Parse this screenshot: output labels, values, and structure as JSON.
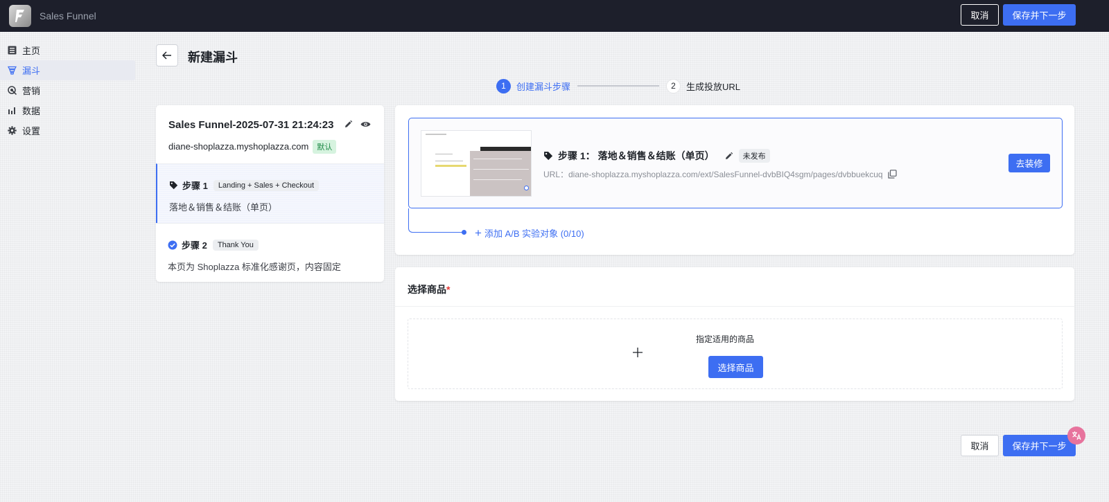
{
  "app": {
    "title": "Sales Funnel"
  },
  "topbar": {
    "cancel_label": "取消",
    "save_label": "保存并下一步"
  },
  "sidebar": {
    "items": [
      {
        "label": "主页",
        "icon": "list-icon"
      },
      {
        "label": "漏斗",
        "icon": "funnel-icon",
        "active": true
      },
      {
        "label": "营销",
        "icon": "target-icon"
      },
      {
        "label": "数据",
        "icon": "bar-chart-icon"
      },
      {
        "label": "设置",
        "icon": "gear-icon"
      }
    ]
  },
  "header": {
    "title": "新建漏斗"
  },
  "stepper": {
    "steps": [
      {
        "number": "1",
        "label": "创建漏斗步骤"
      },
      {
        "number": "2",
        "label": "生成投放URL"
      }
    ]
  },
  "funnel": {
    "name": "Sales Funnel-2025-07-31 21:24:23",
    "domain": "diane-shoplazza.myshoplazza.com",
    "default_badge": "默认",
    "steps": [
      {
        "title": "步骤 1",
        "tag": "Landing + Sales + Checkout",
        "desc": "落地＆销售＆结账（单页）"
      },
      {
        "title": "步骤 2",
        "tag": "Thank You",
        "desc": "本页为 Shoplazza 标准化感谢页，内容固定"
      }
    ]
  },
  "variant": {
    "title": "步骤 1： 落地＆销售＆结账（单页）",
    "status_badge": "未发布",
    "url": "URL：diane-shoplazza.myshoplazza.com/ext/SalesFunnel-dvbBIQ4sgm/pages/dvbbuekcuq",
    "decorate_label": "去装修",
    "add_ab_label": "添加 A/B 实验对象 (0/10)"
  },
  "products": {
    "title": "选择商品",
    "required_mark": "*",
    "hint": "指定适用的商品",
    "select_label": "选择商品"
  },
  "footer": {
    "cancel_label": "取消",
    "save_label": "保存并下一步"
  },
  "colors": {
    "accent": "#3d6ef2",
    "topbar": "#1d1f2b",
    "success_bg": "#d6f3df"
  }
}
